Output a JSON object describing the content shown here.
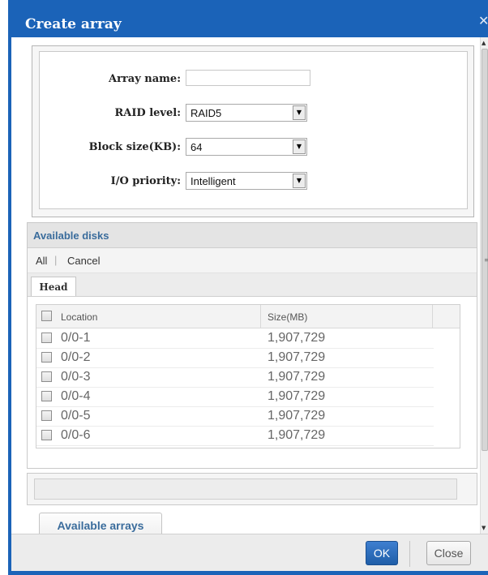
{
  "dialog": {
    "title": "Create array",
    "close_glyph": "✕"
  },
  "form": {
    "array_name_label": "Array name:",
    "array_name_value": "",
    "raid_level_label": "RAID level:",
    "raid_level_value": "RAID5",
    "block_size_label": "Block size(KB):",
    "block_size_value": "64",
    "io_priority_label": "I/O priority:",
    "io_priority_value": "Intelligent",
    "dropdown_glyph": "▼"
  },
  "disks": {
    "title": "Available disks",
    "tool_all": "All",
    "tool_cancel": "Cancel",
    "tab_head": "Head",
    "columns": [
      "Location",
      "Size(MB)"
    ],
    "rows": [
      {
        "location": "0/0-1",
        "size": "1,907,729"
      },
      {
        "location": "0/0-2",
        "size": "1,907,729"
      },
      {
        "location": "0/0-3",
        "size": "1,907,729"
      },
      {
        "location": "0/0-4",
        "size": "1,907,729"
      },
      {
        "location": "0/0-5",
        "size": "1,907,729"
      },
      {
        "location": "0/0-6",
        "size": "1,907,729"
      }
    ]
  },
  "arrays_tab": "Available arrays",
  "footer": {
    "ok_label": "OK",
    "close_label": "Close"
  },
  "icons": {
    "scroll_up": "scroll-up-arrow-icon",
    "scroll_down": "scroll-down-arrow-icon",
    "checkbox": "checkbox-icon"
  },
  "colors": {
    "title_bar": "#1b63b8",
    "section_title": "#3a6c9c",
    "ok_button": "#1f5ea8"
  }
}
